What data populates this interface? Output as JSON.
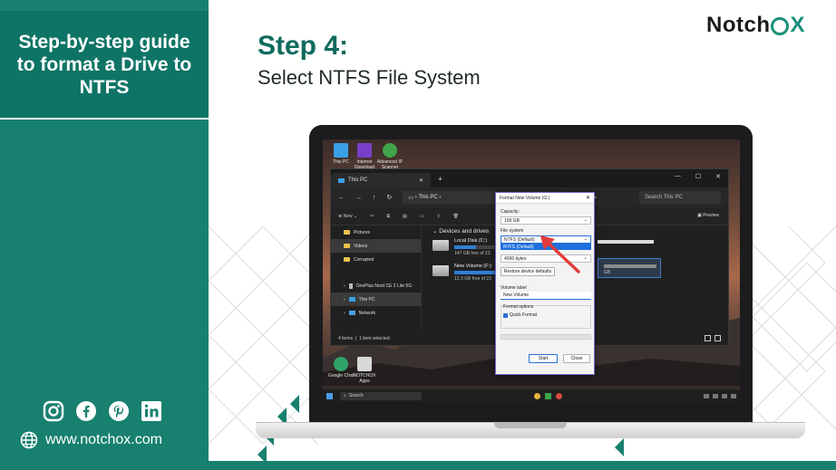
{
  "left": {
    "title": "Step-by-step guide to format a Drive to NTFS",
    "website": "www.notchox.com",
    "socials": [
      "instagram-icon",
      "facebook-icon",
      "pinterest-icon",
      "linkedin-icon"
    ]
  },
  "header": {
    "step": "Step 4:",
    "subtitle": "Select NTFS File System",
    "brand_prefix": "Notch",
    "brand_suffix": "X"
  },
  "colors": {
    "brand_green": "#18806f",
    "dark_green": "#0e6b5d",
    "accent_blue": "#2a6fd6",
    "arrow_red": "#e23b3b"
  },
  "desktop": {
    "icons": [
      {
        "label": "This PC",
        "icon": "monitor-icon"
      },
      {
        "label": "Internet Download Manager",
        "icon": "idm-icon"
      },
      {
        "label": "Advanced IP Scanner",
        "icon": "scanner-icon"
      }
    ],
    "bottom_icons": [
      {
        "label": "Google Chat",
        "icon": "chat-icon"
      },
      {
        "label": "NOTCHOX Apps",
        "icon": "apps-icon"
      }
    ]
  },
  "explorer": {
    "tab_title": "This PC",
    "address": "This PC",
    "search_placeholder": "Search This PC",
    "new_label": "New",
    "preview_label": "Preview",
    "nav": [
      {
        "label": "Pictures",
        "type": "folder"
      },
      {
        "label": "Videos",
        "type": "folder",
        "selected": true
      },
      {
        "label": "Corrupted",
        "type": "folder"
      },
      {
        "label": "OnePlus Nord CE 2 Lite 5G",
        "type": "device"
      },
      {
        "label": "This PC",
        "type": "pc",
        "selected": true
      },
      {
        "label": "Network",
        "type": "network"
      }
    ],
    "section_title": "Devices and drives",
    "drives": [
      {
        "name": "Local Disk (C:)",
        "free": "147 GB free of 23",
        "used_fraction": 0.4
      },
      {
        "name": "New Volume (F:)",
        "free": "12.3 GB free of 23",
        "used_fraction": 0.9
      }
    ],
    "right_fragment": "GB",
    "status_items": "4 items",
    "status_selected": "1 item selected"
  },
  "dialog": {
    "title": "Format New Volume (G:)",
    "capacity_label": "Capacity:",
    "capacity_value": "199 GB",
    "filesystem_label": "File system",
    "filesystem_value": "NTFS (Default)",
    "filesystem_option": "NTFS (Default)",
    "allocation_value": "4096 bytes",
    "restore_label": "Restore device defaults",
    "volume_label": "Volume label",
    "volume_value": "New Volume",
    "options_label": "Format options",
    "quick_format": "Quick Format",
    "start_label": "Start",
    "close_label": "Close"
  },
  "taskbar": {
    "search": "Search"
  }
}
